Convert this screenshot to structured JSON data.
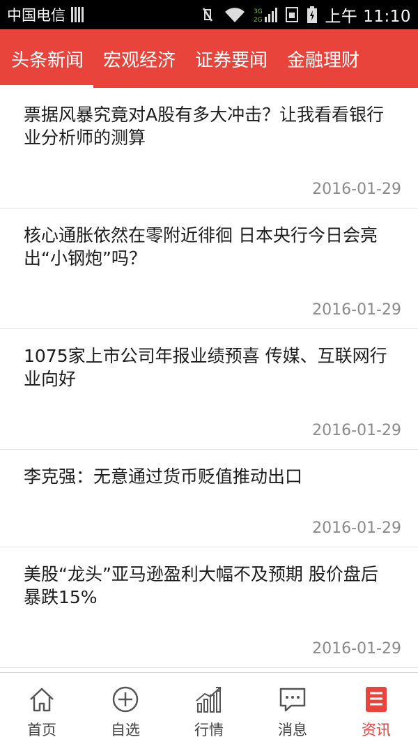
{
  "status_bar": {
    "carrier": "中国电信",
    "network": "3G 2G",
    "time": "上午 11:10"
  },
  "tabs": [
    {
      "label": "头条新闻",
      "active": true
    },
    {
      "label": "宏观经济",
      "active": false
    },
    {
      "label": "证券要闻",
      "active": false
    },
    {
      "label": "金融理财",
      "active": false
    }
  ],
  "news": [
    {
      "title": "票据风暴究竟对A股有多大冲击？让我看看银行业分析师的测算",
      "date": "2016-01-29"
    },
    {
      "title": "核心通胀依然在零附近徘徊 日本央行今日会亮出“小钢炮”吗？",
      "date": "2016-01-29"
    },
    {
      "title": "1075家上市公司年报业绩预喜 传媒、互联网行业向好",
      "date": "2016-01-29"
    },
    {
      "title": "李克强：无意通过货币贬值推动出口",
      "date": "2016-01-29"
    },
    {
      "title": "美股“龙头”亚马逊盈利大幅不及预期 股价盘后暴跌15%",
      "date": "2016-01-29"
    }
  ],
  "bottom_nav": [
    {
      "label": "首页",
      "icon": "home-icon",
      "active": false
    },
    {
      "label": "自选",
      "icon": "add-circle-icon",
      "active": false
    },
    {
      "label": "行情",
      "icon": "market-chart-icon",
      "active": false
    },
    {
      "label": "消息",
      "icon": "message-icon",
      "active": false
    },
    {
      "label": "资讯",
      "icon": "news-icon",
      "active": true
    }
  ],
  "colors": {
    "accent": "#e8443b",
    "text": "#1c1c1c",
    "date": "#8a8a8a"
  }
}
